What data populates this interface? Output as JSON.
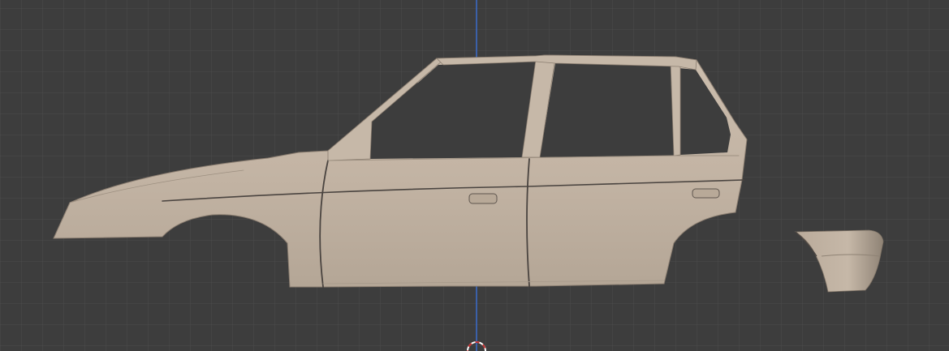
{
  "viewport": {
    "view": "right-orthographic",
    "background_color": "#3d3d3d",
    "grid_color": "#4b4b4b",
    "axis_color": "#3b6fd6",
    "cursor_color": "#c83232"
  },
  "model": {
    "body_color": "#c3b4a4",
    "panel_line_color": "#4a4440",
    "parts": [
      "car-body-side",
      "rear-bumper-piece"
    ]
  }
}
